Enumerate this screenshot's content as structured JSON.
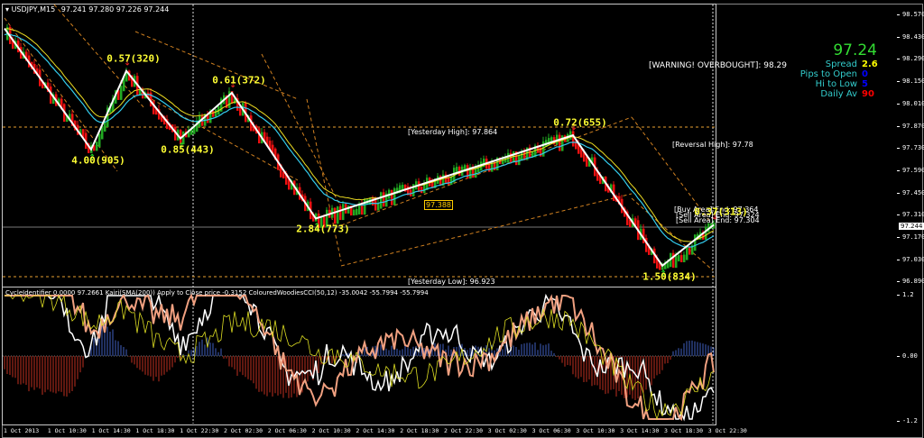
{
  "window": {
    "symbol_title": "USDJPY,M15",
    "ohlc": "97.241 97.280 97.226 97.244"
  },
  "price_axis": {
    "labels": [
      "98.570",
      "98.430",
      "98.290",
      "98.150",
      "98.010",
      "97.870",
      "97.730",
      "97.590",
      "97.450",
      "97.310",
      "97.170",
      "97.030",
      "96.890"
    ],
    "current_price": "97.244"
  },
  "indicator_axis": {
    "labels": [
      "1.2",
      "0.00",
      "-1.2"
    ]
  },
  "time_axis": {
    "labels": [
      "1 Oct 2013",
      "1 Oct 10:30",
      "1 Oct 14:30",
      "1 Oct 18:30",
      "1 Oct 22:30",
      "2 Oct 02:30",
      "2 Oct 06:30",
      "2 Oct 10:30",
      "2 Oct 14:30",
      "2 Oct 18:30",
      "2 Oct 22:30",
      "3 Oct 02:30",
      "3 Oct 06:30",
      "3 Oct 10:30",
      "3 Oct 14:30",
      "3 Oct 18:30",
      "3 Oct 22:30"
    ]
  },
  "info_panel": {
    "price": "97.24",
    "spread_label": "Spread",
    "spread": "2.6",
    "pips_open_label": "Pips to Open",
    "pips_open": "0",
    "hi_low_label": "Hi to Low",
    "hi_low": "5",
    "daily_av_label": "Daily Av",
    "daily_av": "90",
    "colors": {
      "price": "#33dd33",
      "spread": "#ffff00",
      "pips": "#0000ff",
      "daily": "#ff0000"
    }
  },
  "annotations": {
    "warning": "[WARNING! OVERBOUGHT]: 98.29",
    "yesterday_high": "[Yesterday High]: 97.864",
    "yesterday_low": "[Yesterday Low]: 96.923",
    "reversal_high": "[Reversal High]: 97.78",
    "buy_area": "[Buy Area] End: 97.364",
    "sell_area": "[Sell Area] End: 97.324",
    "sell_area2": "[Sell Area] End: 97.304",
    "box_price": "97.388"
  },
  "zigzag": {
    "pivots": [
      {
        "bar": 0,
        "price": 98.5
      },
      {
        "bar": 32,
        "price": 97.73
      },
      {
        "bar": 45,
        "price": 98.23
      },
      {
        "bar": 65,
        "price": 97.8
      },
      {
        "bar": 84,
        "price": 98.09
      },
      {
        "bar": 115,
        "price": 97.29
      },
      {
        "bar": 210,
        "price": 97.82
      },
      {
        "bar": 243,
        "price": 96.99
      },
      {
        "bar": 262,
        "price": 97.25
      }
    ],
    "labels": [
      "4.00(905)",
      "0.57(320)",
      "0.85(443)",
      "0.61(372)",
      "2.84(773)",
      "0.72(655)",
      "1.50(834)",
      "0.37(313)"
    ]
  },
  "indicator_header": "CycleIdentifier 0.0000 97.2661  Kairi(SMA(200)) Apply to Close price -0.3152  ColouredWoodiesCCI(50,12) -35.0042 -55.7994 -55.7994"
}
